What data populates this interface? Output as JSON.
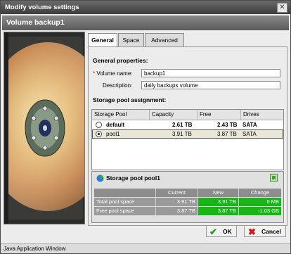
{
  "window": {
    "title": "Modify volume settings",
    "close_icon": "close-icon"
  },
  "header": {
    "title": "Volume backup1"
  },
  "tabs": [
    {
      "label": "General",
      "active": true
    },
    {
      "label": "Space",
      "active": false
    },
    {
      "label": "Advanced",
      "active": false
    }
  ],
  "general": {
    "section_title": "General properties:",
    "required_mark": "*",
    "volume_name_label": "Volume name:",
    "volume_name_value": "backup1",
    "description_label": "Description:",
    "description_value": "daily backups volume"
  },
  "pool_assignment": {
    "section_title": "Storage pool assignment:",
    "columns": [
      "Storage Pool",
      "Capacity",
      "Free",
      "Drives"
    ],
    "rows": [
      {
        "pool": "default",
        "capacity": "2.61 TB",
        "free": "2.43 TB",
        "drives": "SATA",
        "selected": false
      },
      {
        "pool": "pool1",
        "capacity": "3.91 TB",
        "free": "3.87 TB",
        "drives": "SATA",
        "selected": true
      }
    ]
  },
  "summary": {
    "title": "Storage pool pool1",
    "columns": [
      "Current",
      "New",
      "Change"
    ],
    "rows": [
      {
        "label": "Total pool space",
        "current": "3.91 TB",
        "new": "3.91 TB",
        "change": "0 MB"
      },
      {
        "label": "Free pool space",
        "current": "3.87 TB",
        "new": "3.87 TB",
        "change": "-1.03 GB"
      }
    ]
  },
  "buttons": {
    "ok": "OK",
    "cancel": "Cancel"
  },
  "status_bar": "Java Application Window",
  "colors": {
    "accent_green": "#18b418",
    "titlebar": "#4a4a4a",
    "cancel_red": "#d01818"
  }
}
